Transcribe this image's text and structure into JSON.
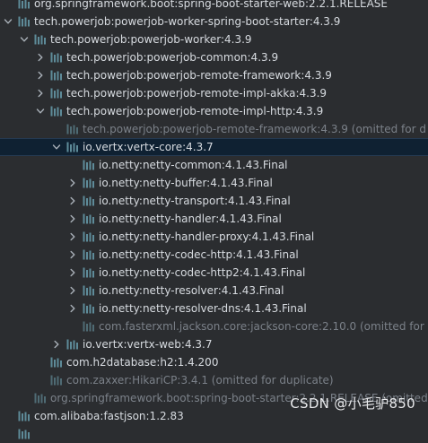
{
  "tree": {
    "rows": [
      {
        "indent": 1,
        "arrow": "none",
        "icon": "library-icon",
        "label": "org.springframework.boot:spring-boot-starter-web:2.2.1.RELEASE",
        "style": "normal",
        "partial": true
      },
      {
        "indent": 1,
        "arrow": "down",
        "icon": "library-icon",
        "label": "tech.powerjob:powerjob-worker-spring-boot-starter:4.3.9",
        "style": "normal"
      },
      {
        "indent": 2,
        "arrow": "down",
        "icon": "library-icon",
        "label": "tech.powerjob:powerjob-worker:4.3.9",
        "style": "normal"
      },
      {
        "indent": 3,
        "arrow": "right",
        "icon": "library-icon",
        "label": "tech.powerjob:powerjob-common:4.3.9",
        "style": "normal"
      },
      {
        "indent": 3,
        "arrow": "right",
        "icon": "library-icon",
        "label": "tech.powerjob:powerjob-remote-framework:4.3.9",
        "style": "normal"
      },
      {
        "indent": 3,
        "arrow": "right",
        "icon": "library-icon",
        "label": "tech.powerjob:powerjob-remote-impl-akka:4.3.9",
        "style": "normal"
      },
      {
        "indent": 3,
        "arrow": "down",
        "icon": "library-icon",
        "label": "tech.powerjob:powerjob-remote-impl-http:4.3.9",
        "style": "normal"
      },
      {
        "indent": 4,
        "arrow": "none",
        "icon": "library-icon",
        "label": "tech.powerjob:powerjob-remote-framework:4.3.9 (omitted for d",
        "style": "omitted"
      },
      {
        "indent": 4,
        "arrow": "down",
        "icon": "library-icon",
        "label": "io.vertx:vertx-core:4.3.7",
        "style": "normal",
        "selected": true
      },
      {
        "indent": 5,
        "arrow": "none",
        "icon": "library-icon",
        "label": "io.netty:netty-common:4.1.43.Final",
        "style": "normal"
      },
      {
        "indent": 5,
        "arrow": "right",
        "icon": "library-icon",
        "label": "io.netty:netty-buffer:4.1.43.Final",
        "style": "normal"
      },
      {
        "indent": 5,
        "arrow": "right",
        "icon": "library-icon",
        "label": "io.netty:netty-transport:4.1.43.Final",
        "style": "normal"
      },
      {
        "indent": 5,
        "arrow": "right",
        "icon": "library-icon",
        "label": "io.netty:netty-handler:4.1.43.Final",
        "style": "normal"
      },
      {
        "indent": 5,
        "arrow": "right",
        "icon": "library-icon",
        "label": "io.netty:netty-handler-proxy:4.1.43.Final",
        "style": "normal"
      },
      {
        "indent": 5,
        "arrow": "right",
        "icon": "library-icon",
        "label": "io.netty:netty-codec-http:4.1.43.Final",
        "style": "normal"
      },
      {
        "indent": 5,
        "arrow": "right",
        "icon": "library-icon",
        "label": "io.netty:netty-codec-http2:4.1.43.Final",
        "style": "normal"
      },
      {
        "indent": 5,
        "arrow": "right",
        "icon": "library-icon",
        "label": "io.netty:netty-resolver:4.1.43.Final",
        "style": "normal"
      },
      {
        "indent": 5,
        "arrow": "right",
        "icon": "library-icon",
        "label": "io.netty:netty-resolver-dns:4.1.43.Final",
        "style": "normal"
      },
      {
        "indent": 5,
        "arrow": "none",
        "icon": "library-icon",
        "label": "com.fasterxml.jackson.core:jackson-core:2.10.0 (omitted for",
        "style": "omitted"
      },
      {
        "indent": 4,
        "arrow": "right",
        "icon": "library-icon",
        "label": "io.vertx:vertx-web:4.3.7",
        "style": "normal"
      },
      {
        "indent": 3,
        "arrow": "none",
        "icon": "library-icon",
        "label": "com.h2database:h2:1.4.200",
        "style": "normal"
      },
      {
        "indent": 3,
        "arrow": "none",
        "icon": "library-icon",
        "label": "com.zaxxer:HikariCP:3.4.1 (omitted for duplicate)",
        "style": "omitted"
      },
      {
        "indent": 2,
        "arrow": "none",
        "icon": "library-icon",
        "label": "org.springframework.boot:spring-boot-starter:2.2.1.RELEASE (omitted",
        "style": "omitted"
      },
      {
        "indent": 1,
        "arrow": "none",
        "icon": "library-icon",
        "label": "com.alibaba:fastjson:1.2.83",
        "style": "normal"
      },
      {
        "indent": 1,
        "arrow": "none",
        "icon": "library-icon",
        "label": "",
        "style": "normal",
        "partial": true
      }
    ]
  },
  "watermark": {
    "text": "CSDN @小毛驴850"
  },
  "colors": {
    "background": "#2b2d30",
    "selected_row": "#0f2132",
    "icon_bars": "#5e8b99",
    "text": "#d7dbe0",
    "omitted_text": "#7b8189"
  }
}
